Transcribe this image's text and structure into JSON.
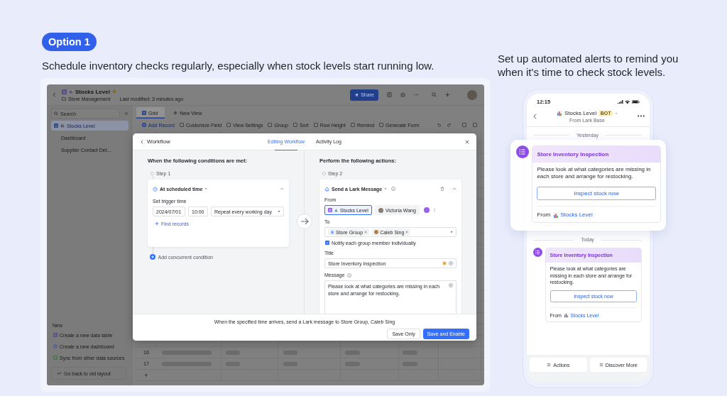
{
  "option_badge": "Option 1",
  "headline": "Schedule inventory checks regularly, especially when stock levels start running low.",
  "app": {
    "title": "Stocks Level",
    "starred": true,
    "folder": "Store Management",
    "modified": "Last modified: 3 minutes ago",
    "share_button": "Share",
    "sidebar": {
      "search_placeholder": "Search",
      "items": [
        {
          "label": "Stocks Level",
          "selected": true,
          "kind": "table"
        },
        {
          "label": "Dashboard",
          "selected": false,
          "kind": "plain"
        },
        {
          "label": "Supplier Contact Det...",
          "selected": false,
          "kind": "plain"
        }
      ],
      "new_heading": "New",
      "new_items": [
        {
          "label": "Create a new data table",
          "kind": "table"
        },
        {
          "label": "Create a new dashboard",
          "kind": "dashboard"
        },
        {
          "label": "Sync from other data sources",
          "kind": "sync"
        }
      ],
      "old_layout_button": "Go back to old layout"
    },
    "views": [
      {
        "label": "Grid",
        "selected": true
      }
    ],
    "new_view_button": "New View",
    "toolbar": [
      {
        "label": "Add Record",
        "kind": "primary"
      },
      {
        "label": "Customize Field",
        "kind": "plain"
      },
      {
        "label": "View Settings",
        "kind": "plain"
      },
      {
        "label": "Group",
        "kind": "plain"
      },
      {
        "label": "Sort",
        "kind": "plain"
      },
      {
        "label": "Row Height",
        "kind": "plain"
      },
      {
        "label": "Remind",
        "kind": "plain"
      },
      {
        "label": "Generate Form",
        "kind": "plain"
      }
    ],
    "grid_rows": [
      {
        "number": "16"
      },
      {
        "number": "17"
      }
    ],
    "add_row_button": "+"
  },
  "workflow": {
    "title": "Workflow",
    "tabs": [
      {
        "label": "Editing Workflow",
        "selected": true
      },
      {
        "label": "Activity Log",
        "selected": false
      }
    ],
    "trigger": {
      "heading": "When the following conditions are met:",
      "step": "Step 1",
      "type": "At scheduled time",
      "time_label": "Set trigger time",
      "date": "2024/07/01",
      "time": "10:00",
      "repeat": "Repeat every working day",
      "find_records": "Find records",
      "add_condition": "Add concurrent condition"
    },
    "action": {
      "heading": "Perform the following actions:",
      "step": "Step 2",
      "type": "Send a Lark Message",
      "from_label": "From",
      "senders": [
        {
          "label": "Stocks Level",
          "selected": true,
          "kind": "base"
        },
        {
          "label": "Victoria Wang",
          "selected": false,
          "kind": "person"
        }
      ],
      "to_label": "To",
      "recipients": [
        {
          "label": "Store Group",
          "kind": "group"
        },
        {
          "label": "Caleb Sing",
          "kind": "person"
        }
      ],
      "notify": {
        "label": "Notify each group member individually",
        "checked": true
      },
      "title_label": "Title",
      "title_value": "Store Inventory Inspection",
      "message_label": "Message",
      "message_value": "Please look at what categories are missing in each store and arrange for restocking."
    },
    "summary": "When the specified time arrives, send a Lark message to Store Group, Caleb Sing",
    "buttons": [
      {
        "label": "Save Only",
        "kind": "secondary"
      },
      {
        "label": "Save and Enable",
        "kind": "primary"
      }
    ]
  },
  "side_note": "Set up automated alerts to remind you when it's time to check stock levels.",
  "phone": {
    "time": "12:15",
    "chat_title": "Stocks Level",
    "bot_badge": "BOT",
    "chat_subtitle": "From Lark Base",
    "messages": [
      {
        "date": "Yesterday",
        "highlighted": true,
        "title": "Store Inventory Inspection",
        "body": "Please look at what categories are missing in each store and arrange for restocking.",
        "button": "Inspect stock now",
        "from_label": "From",
        "from_source": "Stocks Level"
      },
      {
        "date": "Today",
        "highlighted": false,
        "title": "Store Inventory Inspection",
        "body": "Please look at what categories are missing in each store and arrange for restocking.",
        "button": "Inspect stock now",
        "from_label": "From",
        "from_source": "Stocks Level"
      }
    ],
    "menu": [
      "Actions",
      "Discover More"
    ]
  }
}
